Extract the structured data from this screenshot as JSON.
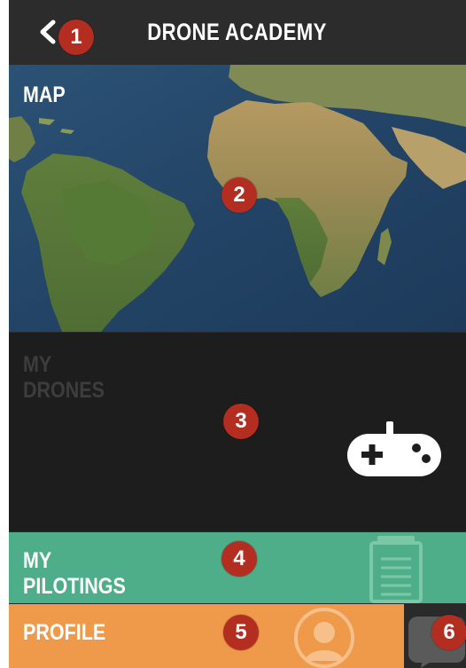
{
  "header": {
    "title": "DRONE ACADEMY",
    "back_icon": "chevron-left-icon"
  },
  "tiles": {
    "map": {
      "label": "MAP",
      "image": "world-map-satellite"
    },
    "drones": {
      "label": "MY\nDRONES",
      "icon": "gamepad-icon"
    },
    "pilotings": {
      "label": "MY\nPILOTINGS",
      "icon": "clipboard-icon"
    },
    "profile": {
      "label": "PROFILE",
      "icon": "user-avatar-icon"
    },
    "chat": {
      "icon": "chat-bubble-icon"
    }
  },
  "annotations": [
    "1",
    "2",
    "3",
    "4",
    "5",
    "6"
  ],
  "colors": {
    "header": "#2c2c2c",
    "drones": "#1d1d1d",
    "pilotings": "#4fae8a",
    "profile": "#ef9a4a",
    "badge": "#b32d20"
  }
}
